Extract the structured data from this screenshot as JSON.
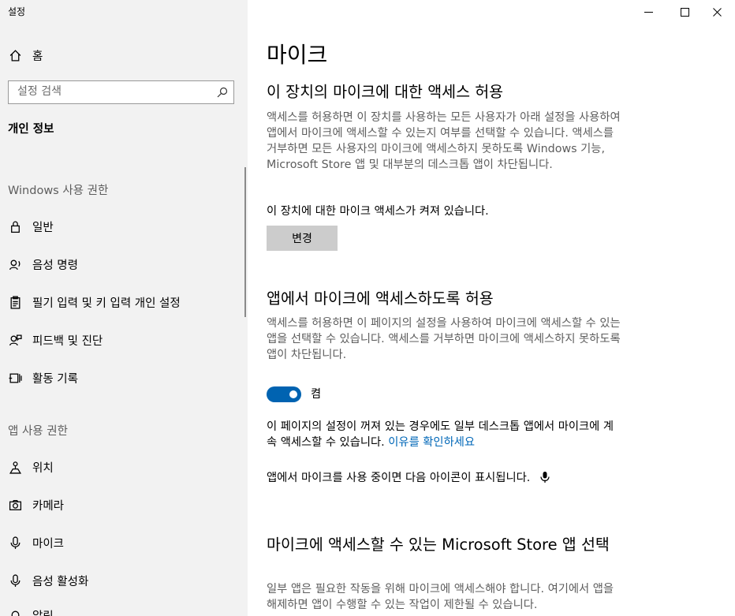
{
  "window": {
    "title": "설정",
    "controls": {
      "minimize": "minimize-icon",
      "maximize": "maximize-icon",
      "close": "close-icon"
    }
  },
  "sidebar": {
    "home_label": "홈",
    "search_placeholder": "설정 검색",
    "section_title": "개인 정보",
    "windows_permissions_header": "Windows 사용 권한",
    "windows_items": [
      {
        "label": "일반",
        "icon": "lock-icon"
      },
      {
        "label": "음성 명령",
        "icon": "speech-icon"
      },
      {
        "label": "필기 입력 및 키 입력 개인 설정",
        "icon": "clipboard-icon"
      },
      {
        "label": "피드백 및 진단",
        "icon": "feedback-icon"
      },
      {
        "label": "활동 기록",
        "icon": "activity-icon"
      }
    ],
    "app_permissions_header": "앱 사용 권한",
    "app_items": [
      {
        "label": "위치",
        "icon": "location-icon"
      },
      {
        "label": "카메라",
        "icon": "camera-icon"
      },
      {
        "label": "마이크",
        "icon": "microphone-icon"
      },
      {
        "label": "음성 활성화",
        "icon": "voice-activation-icon"
      },
      {
        "label": "알림",
        "icon": "notification-icon"
      }
    ]
  },
  "main": {
    "page_title": "마이크",
    "device_access": {
      "heading": "이 장치의 마이크에 대한 액세스 허용",
      "description": "액세스를 허용하면 이 장치를 사용하는 모든 사용자가 아래 설정을 사용하여 앱에서 마이크에 액세스할 수 있는지 여부를 선택할 수 있습니다. 액세스를 거부하면 모든 사용자의 마이크에 액세스하지 못하도록 Windows 기능, Microsoft Store 앱 및 대부분의 데스크톱 앱이 차단됩니다.",
      "status": "이 장치에 대한 마이크 액세스가 켜져 있습니다.",
      "change_button": "변경"
    },
    "app_access": {
      "heading": "앱에서 마이크에 액세스하도록 허용",
      "description": "액세스를 허용하면 이 페이지의 설정을 사용하여 마이크에 액세스할 수 있는 앱을 선택할 수 있습니다. 액세스를 거부하면 마이크에 액세스하지 못하도록 앱이 차단됩니다.",
      "toggle_state": "켬",
      "note": "이 페이지의 설정이 꺼져 있는 경우에도 일부 데스크톱 앱에서 마이크에 계속 액세스할 수 있습니다.",
      "note_link": "이유를 확인하세요",
      "icon_note": "앱에서 마이크를 사용 중이면 다음 아이콘이 표시됩니다."
    },
    "store_apps": {
      "heading": "마이크에 액세스할 수 있는 Microsoft Store 앱 선택",
      "description": "일부 앱은 필요한 작동을 위해 마이크에 액세스해야 합니다. 여기에서 앱을 해제하면 앱이 수행할 수 있는 작업이 제한될 수 있습니다."
    }
  },
  "colors": {
    "sidebar_bg": "#f2f2f2",
    "accent": "#0063b1",
    "link": "#0067b8",
    "secondary_text": "#5d5d5d",
    "button_bg": "#cccccc"
  }
}
